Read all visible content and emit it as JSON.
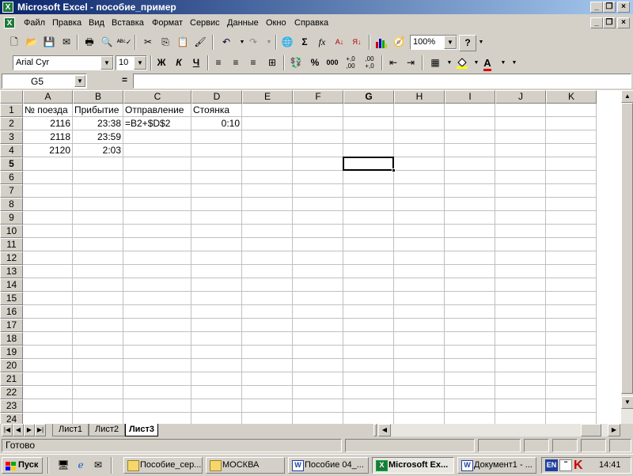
{
  "window": {
    "title": "Microsoft Excel - пособие_пример"
  },
  "menu": [
    "Файл",
    "Правка",
    "Вид",
    "Вставка",
    "Формат",
    "Сервис",
    "Данные",
    "Окно",
    "Справка"
  ],
  "toolbar": {
    "zoom": "100%",
    "help_label": "?"
  },
  "format_toolbar": {
    "font": "Arial Cyr",
    "size": "10",
    "bold": "Ж",
    "italic": "К",
    "underline": "Ч",
    "percent": "%",
    "thousands": "000",
    "inc_decimal": "+,0 ,00",
    "dec_decimal": ",00 +,0"
  },
  "formula_bar": {
    "name_box": "G5",
    "equals": "="
  },
  "columns": [
    "A",
    "B",
    "C",
    "D",
    "E",
    "F",
    "G",
    "H",
    "I",
    "J",
    "K"
  ],
  "rows": [
    "1",
    "2",
    "3",
    "4",
    "5",
    "6",
    "7",
    "8",
    "9",
    "10",
    "11",
    "12",
    "13",
    "14",
    "15",
    "16",
    "17",
    "18",
    "19",
    "20",
    "21",
    "22",
    "23",
    "24"
  ],
  "cells": {
    "A1": "№ поезда",
    "B1": "Прибытие",
    "C1": "Отправление",
    "D1": "Стоянка",
    "A2": "2116",
    "B2": "23:38",
    "C2": "=B2+$D$2",
    "D2": "0:10",
    "A3": "2118",
    "B3": "23:59",
    "A4": "2120",
    "B4": "2:03"
  },
  "sheets": {
    "tabs": [
      "Лист1",
      "Лист2",
      "Лист3"
    ],
    "active": "Лист3"
  },
  "status": {
    "text": "Готово"
  },
  "taskbar": {
    "start": "Пуск",
    "tasks": [
      "Пособие_сер...",
      "МОСКВА",
      "Пособие 04_...",
      "Microsoft Ex...",
      "Документ1 - ..."
    ],
    "active_task": "Microsoft Ex...",
    "tray_lang": "EN",
    "clock": "14:41"
  }
}
